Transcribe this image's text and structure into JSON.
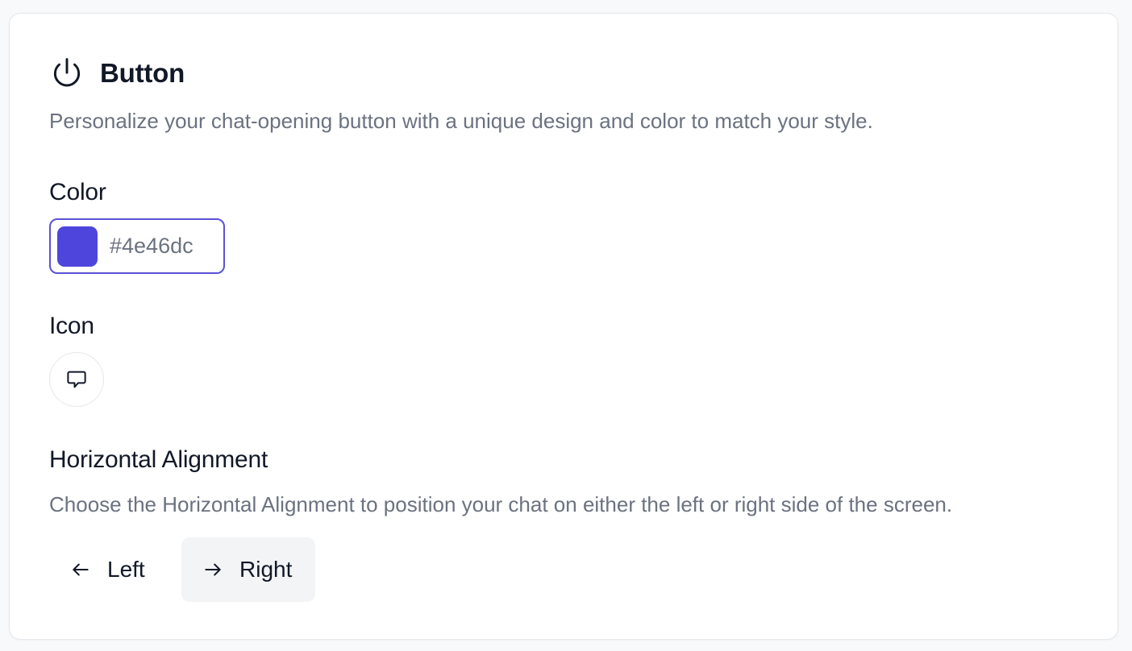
{
  "section": {
    "title": "Button",
    "icon": "power-icon",
    "description": "Personalize your chat-opening button with a unique design and color to match your style."
  },
  "color": {
    "label": "Color",
    "value": "#4e46dc",
    "swatch_color": "#4e46dc"
  },
  "icon_setting": {
    "label": "Icon",
    "selected_icon": "chat-bubble-icon"
  },
  "alignment": {
    "label": "Horizontal Alignment",
    "description": "Choose the Horizontal Alignment to position your chat on either the left or right side of the screen.",
    "options": [
      {
        "label": "Left",
        "icon": "arrow-left-icon",
        "selected": false
      },
      {
        "label": "Right",
        "icon": "arrow-right-icon",
        "selected": true
      }
    ]
  }
}
